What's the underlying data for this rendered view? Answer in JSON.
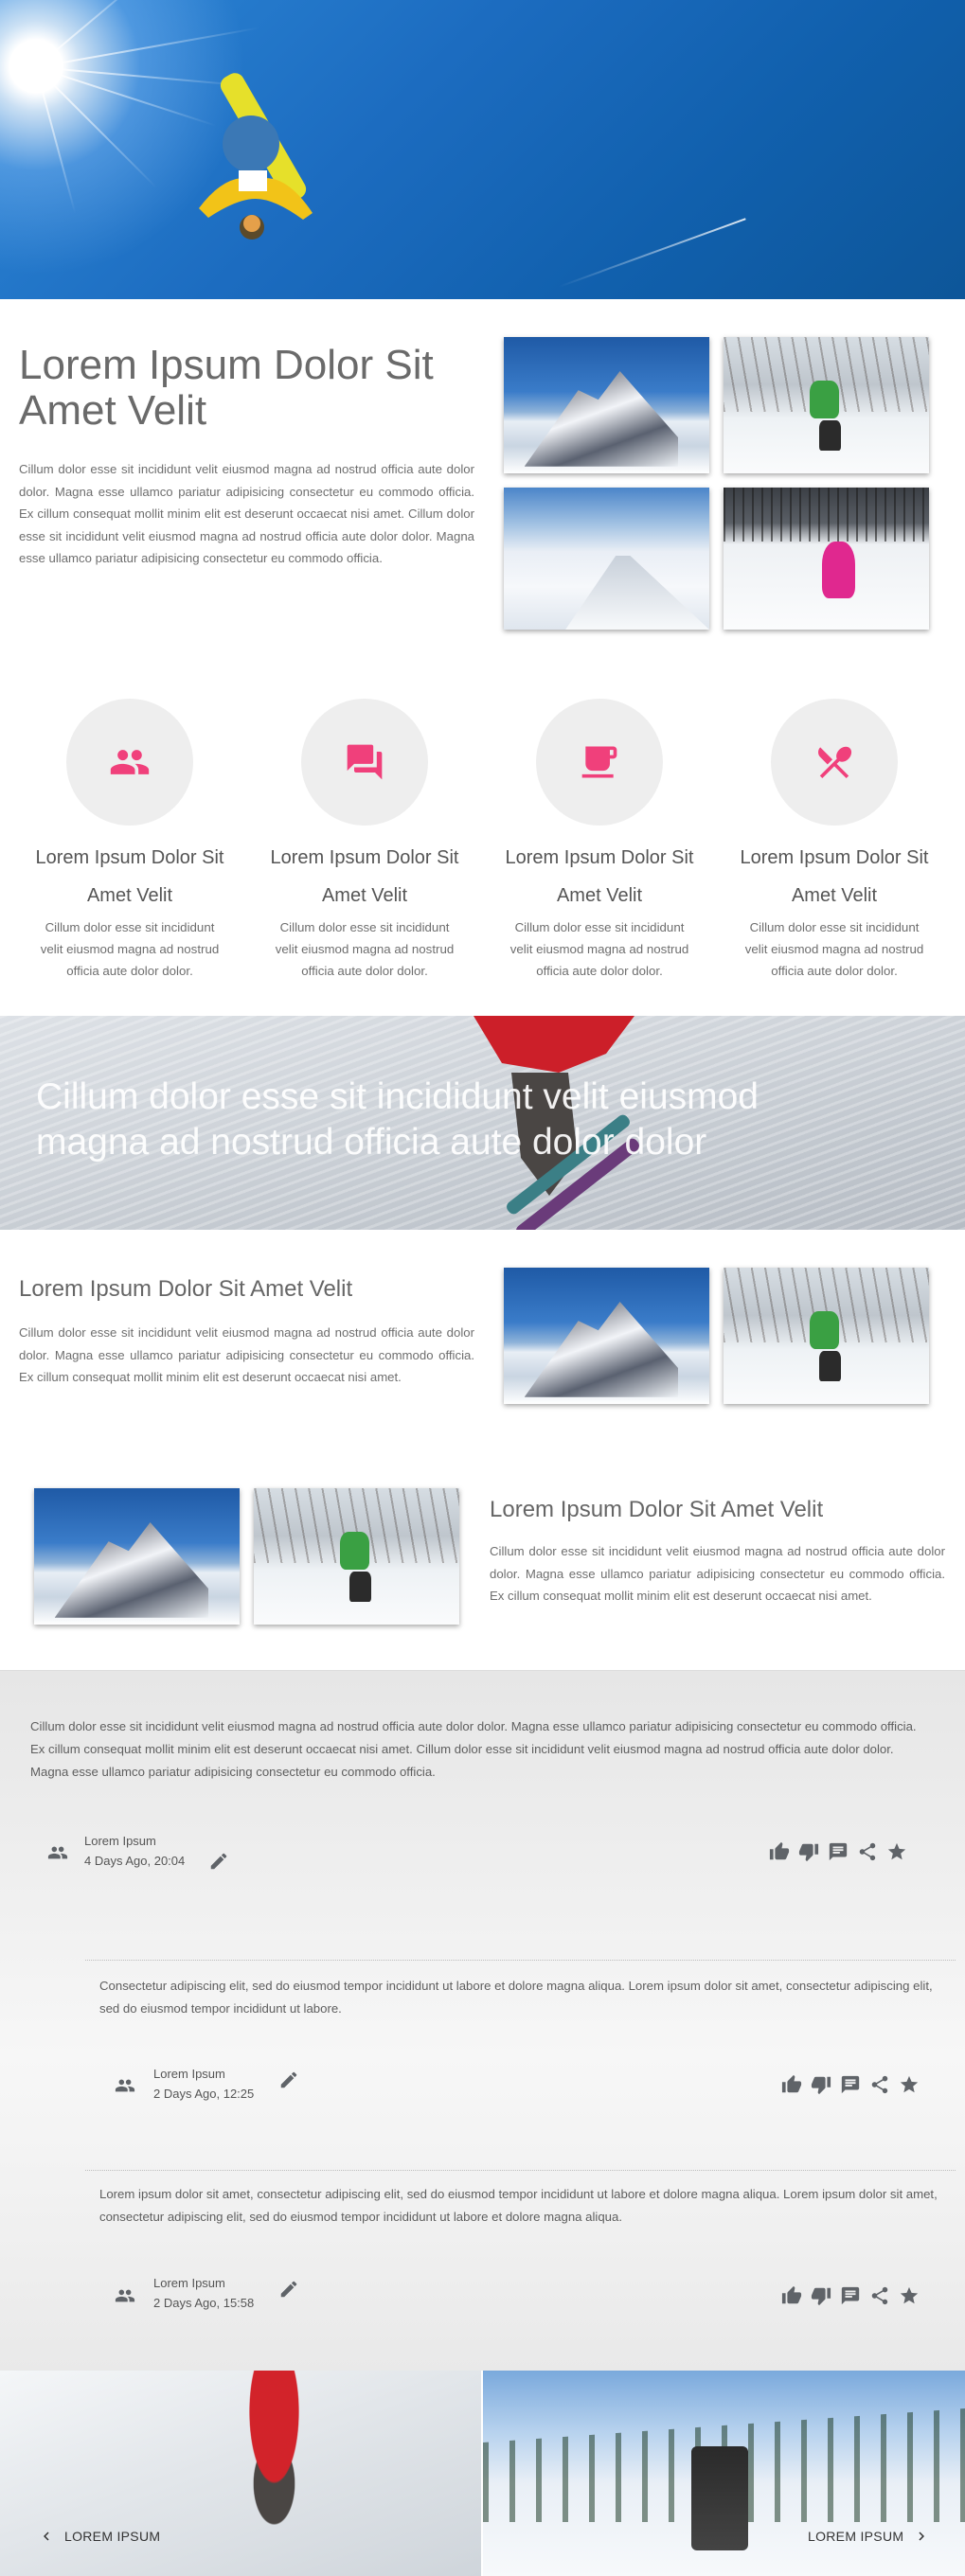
{
  "hero": {
    "alt": "snowboarder jumping against blue sky"
  },
  "section1": {
    "title": "Lorem Ipsum Dolor Sit Amet Velit",
    "paragraph": "Cillum dolor esse sit incididunt velit eiusmod magna ad nostrud officia aute dolor dolor. Magna esse ullamco pariatur adipisicing consectetur eu commodo officia. Ex cillum consequat mollit minim elit est deserunt occaecat nisi amet. Cillum dolor esse sit incididunt velit eiusmod magna ad nostrud officia aute dolor dolor. Magna esse ullamco pariatur adipisicing consectetur eu commodo officia."
  },
  "features": [
    {
      "icon": "people-icon",
      "title": "Lorem Ipsum Dolor Sit Amet Velit",
      "text": "Cillum dolor esse sit incididunt velit eiusmod magna ad nostrud officia aute dolor dolor."
    },
    {
      "icon": "forum-icon",
      "title": "Lorem Ipsum Dolor Sit Amet Velit",
      "text": "Cillum dolor esse sit incididunt velit eiusmod magna ad nostrud officia aute dolor dolor."
    },
    {
      "icon": "coffee-icon",
      "title": "Lorem Ipsum Dolor Sit Amet Velit",
      "text": "Cillum dolor esse sit incididunt velit eiusmod magna ad nostrud officia aute dolor dolor."
    },
    {
      "icon": "restaurant-icon",
      "title": "Lorem Ipsum Dolor Sit Amet Velit",
      "text": "Cillum dolor esse sit incididunt velit eiusmod magna ad nostrud officia aute dolor dolor."
    }
  ],
  "banner": {
    "text": "Cillum dolor esse sit incididunt velit eiusmod magna ad nostrud officia aute dolor dolor"
  },
  "section2": {
    "title": "Lorem Ipsum Dolor Sit Amet Velit",
    "paragraph": "Cillum dolor esse sit incididunt velit eiusmod magna ad nostrud officia aute dolor dolor. Magna esse ullamco pariatur adipisicing consectetur eu commodo officia. Ex cillum consequat mollit minim elit est deserunt occaecat nisi amet."
  },
  "section3": {
    "title": "Lorem Ipsum Dolor Sit Amet Velit",
    "paragraph": "Cillum dolor esse sit incididunt velit eiusmod magna ad nostrud officia aute dolor dolor. Magna esse ullamco pariatur adipisicing consectetur eu commodo officia. Ex cillum consequat mollit minim elit est deserunt occaecat nisi amet."
  },
  "comments": [
    {
      "text": "Cillum dolor esse sit incididunt velit eiusmod magna ad nostrud officia aute dolor dolor. Magna esse ullamco pariatur adipisicing consectetur eu commodo officia. Ex cillum consequat mollit minim elit est deserunt occaecat nisi amet. Cillum dolor esse sit incididunt velit eiusmod magna ad nostrud officia aute dolor dolor. Magna esse ullamco pariatur adipisicing consectetur eu commodo officia.",
      "author": "Lorem Ipsum",
      "date": "4 Days Ago, 20:04"
    },
    {
      "text": "Consectetur adipiscing elit, sed do eiusmod tempor incididunt ut labore et dolore magna aliqua. Lorem ipsum dolor sit amet, consectetur adipiscing elit, sed do eiusmod tempor incididunt ut labore.",
      "author": "Lorem Ipsum",
      "date": "2 Days Ago, 12:25"
    },
    {
      "text": "Lorem ipsum dolor sit amet, consectetur adipiscing elit, sed do eiusmod tempor incididunt ut labore et dolore magna aliqua. Lorem ipsum dolor sit amet, consectetur adipiscing elit, sed do eiusmod tempor incididunt ut labore et dolore magna aliqua.",
      "author": "Lorem Ipsum",
      "date": "2 Days Ago, 15:58"
    }
  ],
  "footer": {
    "prev_label": "LOREM IPSUM",
    "next_label": "LOREM IPSUM"
  },
  "colors": {
    "accent": "#f0407b",
    "hero_sky": "#1c6cc0"
  }
}
